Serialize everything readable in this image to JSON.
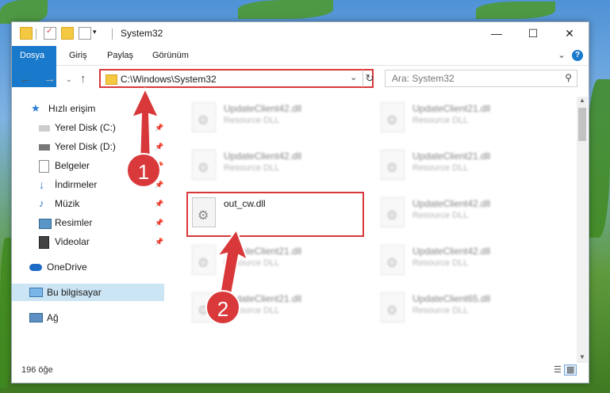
{
  "window": {
    "title": "System32",
    "controls": {
      "minimize": "—",
      "maximize": "☐",
      "close": "✕"
    }
  },
  "ribbon": {
    "tabs": [
      "Dosya",
      "Giriş",
      "Paylaş",
      "Görünüm"
    ],
    "collapse_icon": "⌄",
    "help_icon": "?"
  },
  "address": {
    "path": "C:\\Windows\\System32",
    "search_placeholder": "Ara: System32"
  },
  "sidebar": {
    "items": [
      {
        "label": "Hızlı erişim",
        "icon": "star-icon"
      },
      {
        "label": "Yerel Disk (C:)",
        "icon": "drive-icon",
        "pinned": true
      },
      {
        "label": "Yerel Disk (D:)",
        "icon": "drive-icon",
        "pinned": true
      },
      {
        "label": "Belgeler",
        "icon": "documents-icon",
        "pinned": true
      },
      {
        "label": "İndirmeler",
        "icon": "download-icon",
        "pinned": true
      },
      {
        "label": "Müzik",
        "icon": "music-icon",
        "pinned": true
      },
      {
        "label": "Resimler",
        "icon": "pictures-icon",
        "pinned": true
      },
      {
        "label": "Videolar",
        "icon": "videos-icon",
        "pinned": true
      },
      {
        "label": "OneDrive",
        "icon": "cloud-icon"
      },
      {
        "label": "Bu bilgisayar",
        "icon": "computer-icon",
        "selected": true
      },
      {
        "label": "Ağ",
        "icon": "network-icon"
      }
    ]
  },
  "files": [
    {
      "name": "UpdateClient42.dll",
      "type": "Resource DLL"
    },
    {
      "name": "UpdateClient21.dll",
      "type": "Resource DLL"
    },
    {
      "name": "UpdateClient42.dll",
      "type": "Resource DLL"
    },
    {
      "name": "UpdateClient21.dll",
      "type": "Resource DLL"
    },
    {
      "name": "out_cw.dll",
      "type": ""
    },
    {
      "name": "UpdateClient42.dll",
      "type": "Resource DLL"
    },
    {
      "name": "UpdateClient21.dll",
      "type": "Resource DLL"
    },
    {
      "name": "UpdateClient42.dll",
      "type": "Resource DLL"
    },
    {
      "name": "UpdateClient21.dll",
      "type": "Resource DLL"
    },
    {
      "name": "UpdateClient65.dll",
      "type": "Resource DLL"
    }
  ],
  "status": {
    "count": "196 öğe"
  },
  "annotations": [
    "1",
    "2"
  ],
  "colors": {
    "accent": "#1979ca",
    "highlight": "#d9383a"
  }
}
